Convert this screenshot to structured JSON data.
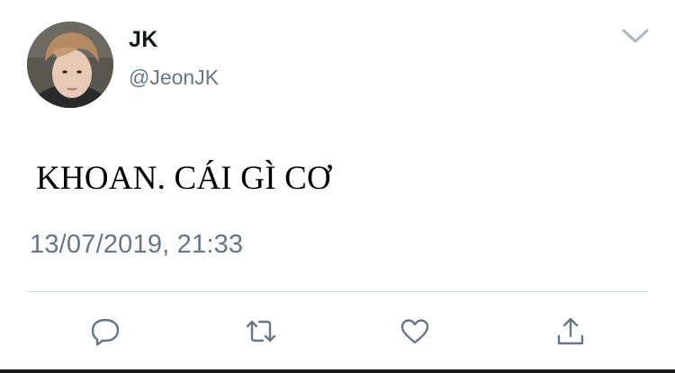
{
  "tweet": {
    "author": {
      "display_name": "JK",
      "handle": "@JeonJK",
      "avatar_icon": "profile-photo"
    },
    "text": "KHOAN. CÁI GÌ CƠ",
    "timestamp": "13/07/2019, 21:33",
    "menu_icon": "chevron-down-icon",
    "actions": [
      {
        "name": "reply",
        "icon": "speech-bubble-icon"
      },
      {
        "name": "retweet",
        "icon": "retweet-arrows-icon"
      },
      {
        "name": "like",
        "icon": "heart-icon"
      },
      {
        "name": "share",
        "icon": "upload-arrow-icon"
      }
    ]
  },
  "colors": {
    "primary_text": "#14171a",
    "secondary_text": "#657786",
    "divider": "#ccd6dd",
    "background": "#ffffff"
  }
}
